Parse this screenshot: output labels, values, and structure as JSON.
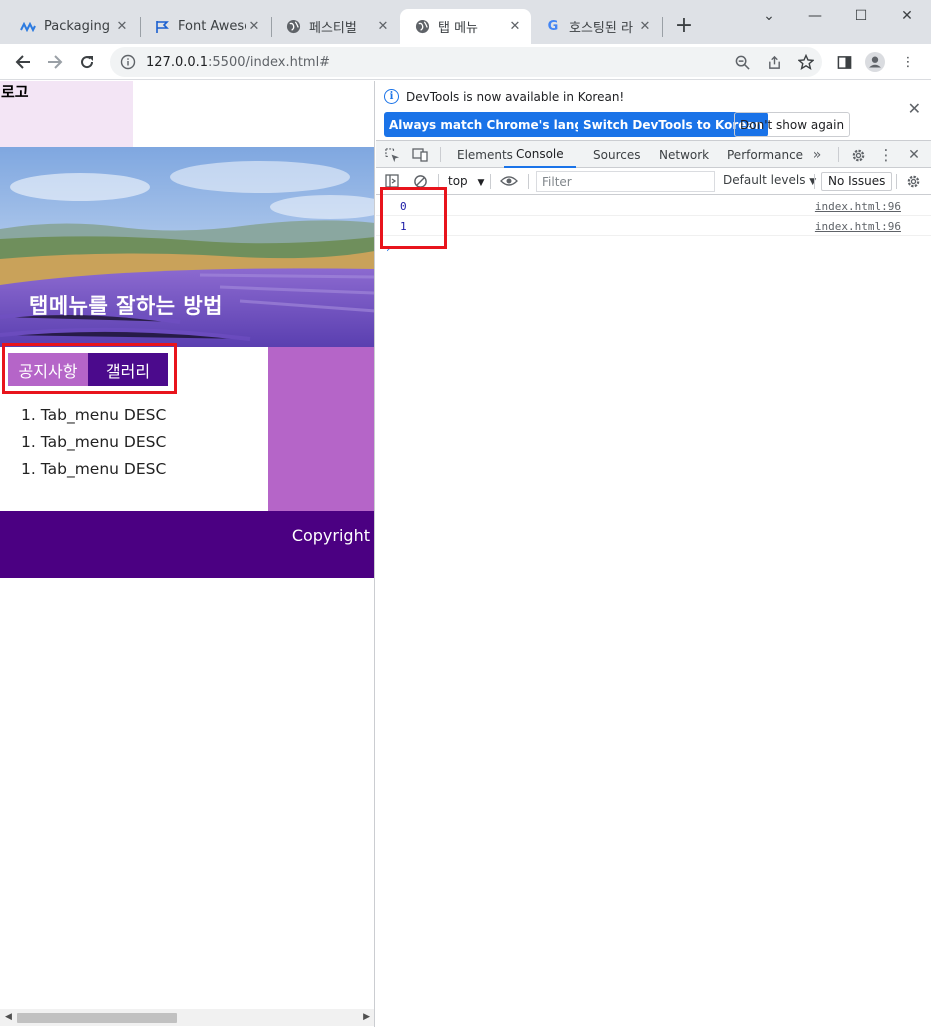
{
  "browser": {
    "tabs": [
      {
        "label": "Packaging A",
        "icon": "packaging-logo-icon",
        "active": false
      },
      {
        "label": "Font Aweso",
        "icon": "flag-icon",
        "active": false
      },
      {
        "label": "페스티벌",
        "icon": "globe-icon",
        "active": false
      },
      {
        "label": "탭 메뉴",
        "icon": "globe-icon",
        "active": true
      },
      {
        "label": "호스팅된 라",
        "icon": "google-icon",
        "active": false
      }
    ],
    "url_host": "127.0.0.1",
    "url_rest": ":5500/index.html#"
  },
  "page": {
    "logo": "로고",
    "hero_title": "탭메뉴를 잘하는 방법",
    "tab_menu": [
      "공지사항",
      "갤러리"
    ],
    "desc_items": [
      "1. Tab_menu DESC",
      "1. Tab_menu DESC",
      "1. Tab_menu DESC"
    ],
    "copyright": "Copyright"
  },
  "devtools": {
    "banner_text": "DevTools is now available in Korean!",
    "btn_match": "Always match Chrome's language",
    "btn_switch": "Switch DevTools to Korean",
    "btn_dont": "Don't show again",
    "tabs": [
      "Elements",
      "Console",
      "Sources",
      "Network",
      "Performance"
    ],
    "active_tab": "Console",
    "context": "top",
    "filter_placeholder": "Filter",
    "levels": "Default levels",
    "issues": "No Issues",
    "logs": [
      {
        "value": "0",
        "source": "index.html:96"
      },
      {
        "value": "1",
        "source": "index.html:96"
      }
    ]
  },
  "colors": {
    "purple_light": "#b565c8",
    "purple_dark": "#4b0082",
    "logo_bg": "#f3e5f5",
    "highlight": "#e8141c",
    "accent": "#1a73e8"
  }
}
